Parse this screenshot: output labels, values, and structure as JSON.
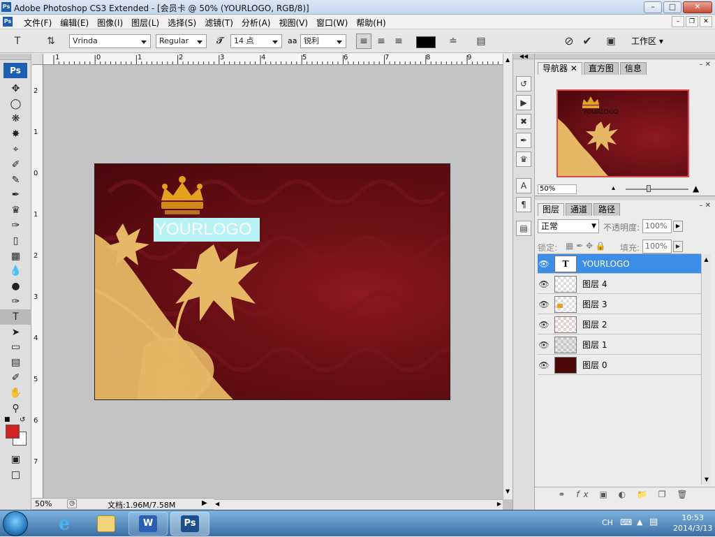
{
  "titlebar": {
    "title": "Adobe Photoshop CS3 Extended - [会员卡 @ 50% (YOURLOGO, RGB/8)]",
    "icon": "Ps"
  },
  "menubar": {
    "items": [
      "文件(F)",
      "编辑(E)",
      "图像(I)",
      "图层(L)",
      "选择(S)",
      "滤镜(T)",
      "分析(A)",
      "视图(V)",
      "窗口(W)",
      "帮助(H)"
    ]
  },
  "options": {
    "font_family": "Vrinda",
    "font_style": "Regular",
    "font_size": "14 点",
    "antialias_icon": "aa",
    "antialias": "锐利",
    "workspace": "工作区",
    "text_color": "#000000"
  },
  "tools": [
    "move-tool",
    "marquee-tool",
    "lasso-tool",
    "magic-wand-tool",
    "crop-tool",
    "eyedropper-tool",
    "healing-brush-tool",
    "brush-tool",
    "clone-stamp-tool",
    "history-brush-tool",
    "eraser-tool",
    "gradient-tool",
    "blur-tool",
    "dodge-tool",
    "pen-tool",
    "type-tool",
    "path-selection-tool",
    "shape-tool",
    "notes-tool",
    "color-sampler-tool",
    "hand-tool",
    "zoom-tool"
  ],
  "toolbox": {
    "badge": "Ps",
    "foreground_color": "#d32020",
    "background_color": "#ffffff"
  },
  "rulers": {
    "horizontal": [
      "1",
      "0",
      "1",
      "2",
      "3",
      "4",
      "5",
      "6",
      "7",
      "8",
      "9"
    ],
    "vertical": [
      "2",
      "1",
      "0",
      "1",
      "2",
      "3",
      "4",
      "5",
      "6",
      "7"
    ]
  },
  "canvas": {
    "logo_text": "YOURLOGO"
  },
  "status": {
    "zoom": "50%",
    "doc_info": "文档:1.96M/7.58M"
  },
  "navigator": {
    "tabs": [
      "导航器",
      "直方图",
      "信息"
    ],
    "zoom": "50%",
    "logo_text": "YOURLOGO"
  },
  "layers_panel": {
    "tabs": [
      "图层",
      "通道",
      "路径"
    ],
    "blend_mode": "正常",
    "opacity_label": "不透明度:",
    "opacity_value": "100%",
    "lock_label": "锁定:",
    "fill_label": "填充:",
    "fill_value": "100%",
    "layers": [
      {
        "name": "YOURLOGO",
        "thumb": "T",
        "active": true
      },
      {
        "name": "图层 4",
        "active": false
      },
      {
        "name": "图层 3",
        "active": false
      },
      {
        "name": "图层 2",
        "active": false
      },
      {
        "name": "图层 1",
        "active": false
      },
      {
        "name": "图层 0",
        "active": false
      }
    ],
    "footer_icons": [
      "link-icon",
      "fx-icon",
      "mask-icon",
      "adjustment-icon",
      "group-icon",
      "new-layer-icon",
      "trash-icon"
    ]
  },
  "taskbar": {
    "apps": [
      "internet-explorer",
      "file-explorer",
      "word",
      "photoshop"
    ],
    "word_label": "W",
    "ps_label": "Ps",
    "ime": "CH",
    "time": "10:53",
    "date": "2014/3/13"
  },
  "colors": {
    "canvas_dark": "#4a080d",
    "canvas_light": "#8e1820",
    "gold": "#e3b35e",
    "selection": "#3d8ee6"
  }
}
